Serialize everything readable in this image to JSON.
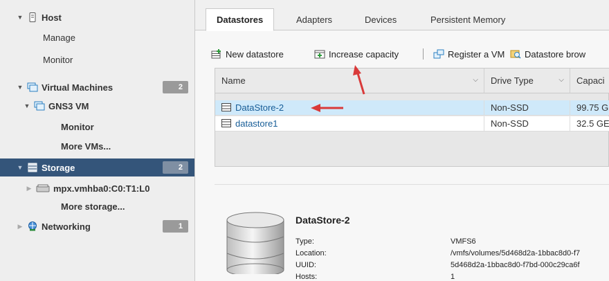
{
  "sidebar": {
    "items": [
      {
        "label": "Host",
        "badge": ""
      },
      {
        "label": "Manage"
      },
      {
        "label": "Monitor"
      },
      {
        "label": "Virtual Machines",
        "badge": "2"
      },
      {
        "label": "GNS3 VM"
      },
      {
        "label": "Monitor"
      },
      {
        "label": "More VMs..."
      },
      {
        "label": "Storage",
        "badge": "2"
      },
      {
        "label": "mpx.vmhba0:C0:T1:L0"
      },
      {
        "label": "More storage..."
      },
      {
        "label": "Networking",
        "badge": "1"
      }
    ]
  },
  "tabs": [
    "Datastores",
    "Adapters",
    "Devices",
    "Persistent Memory"
  ],
  "toolbar": {
    "new_datastore": "New datastore",
    "increase_capacity": "Increase capacity",
    "register_vm": "Register a VM",
    "datastore_browser": "Datastore brow"
  },
  "table": {
    "columns": [
      "Name",
      "Drive Type",
      "Capaci"
    ],
    "rows": [
      {
        "name": "DataStore-2",
        "drive_type": "Non-SSD",
        "capacity": "99.75 G"
      },
      {
        "name": "datastore1",
        "drive_type": "Non-SSD",
        "capacity": "32.5 GE"
      }
    ]
  },
  "details": {
    "title": "DataStore-2",
    "fields": [
      {
        "label": "Type:",
        "value": "VMFS6"
      },
      {
        "label": "Location:",
        "value": "/vmfs/volumes/5d468d2a-1bbac8d0-f7"
      },
      {
        "label": "UUID:",
        "value": "5d468d2a-1bbac8d0-f7bd-000c29ca6f"
      },
      {
        "label": "Hosts:",
        "value": "1"
      }
    ]
  },
  "colors": {
    "sidebar_bg": "#eeeeee",
    "selected_nav": "#34557a",
    "selected_row": "#cfe9fa",
    "link": "#175d97",
    "annotation_arrow": "#d93a3a"
  }
}
